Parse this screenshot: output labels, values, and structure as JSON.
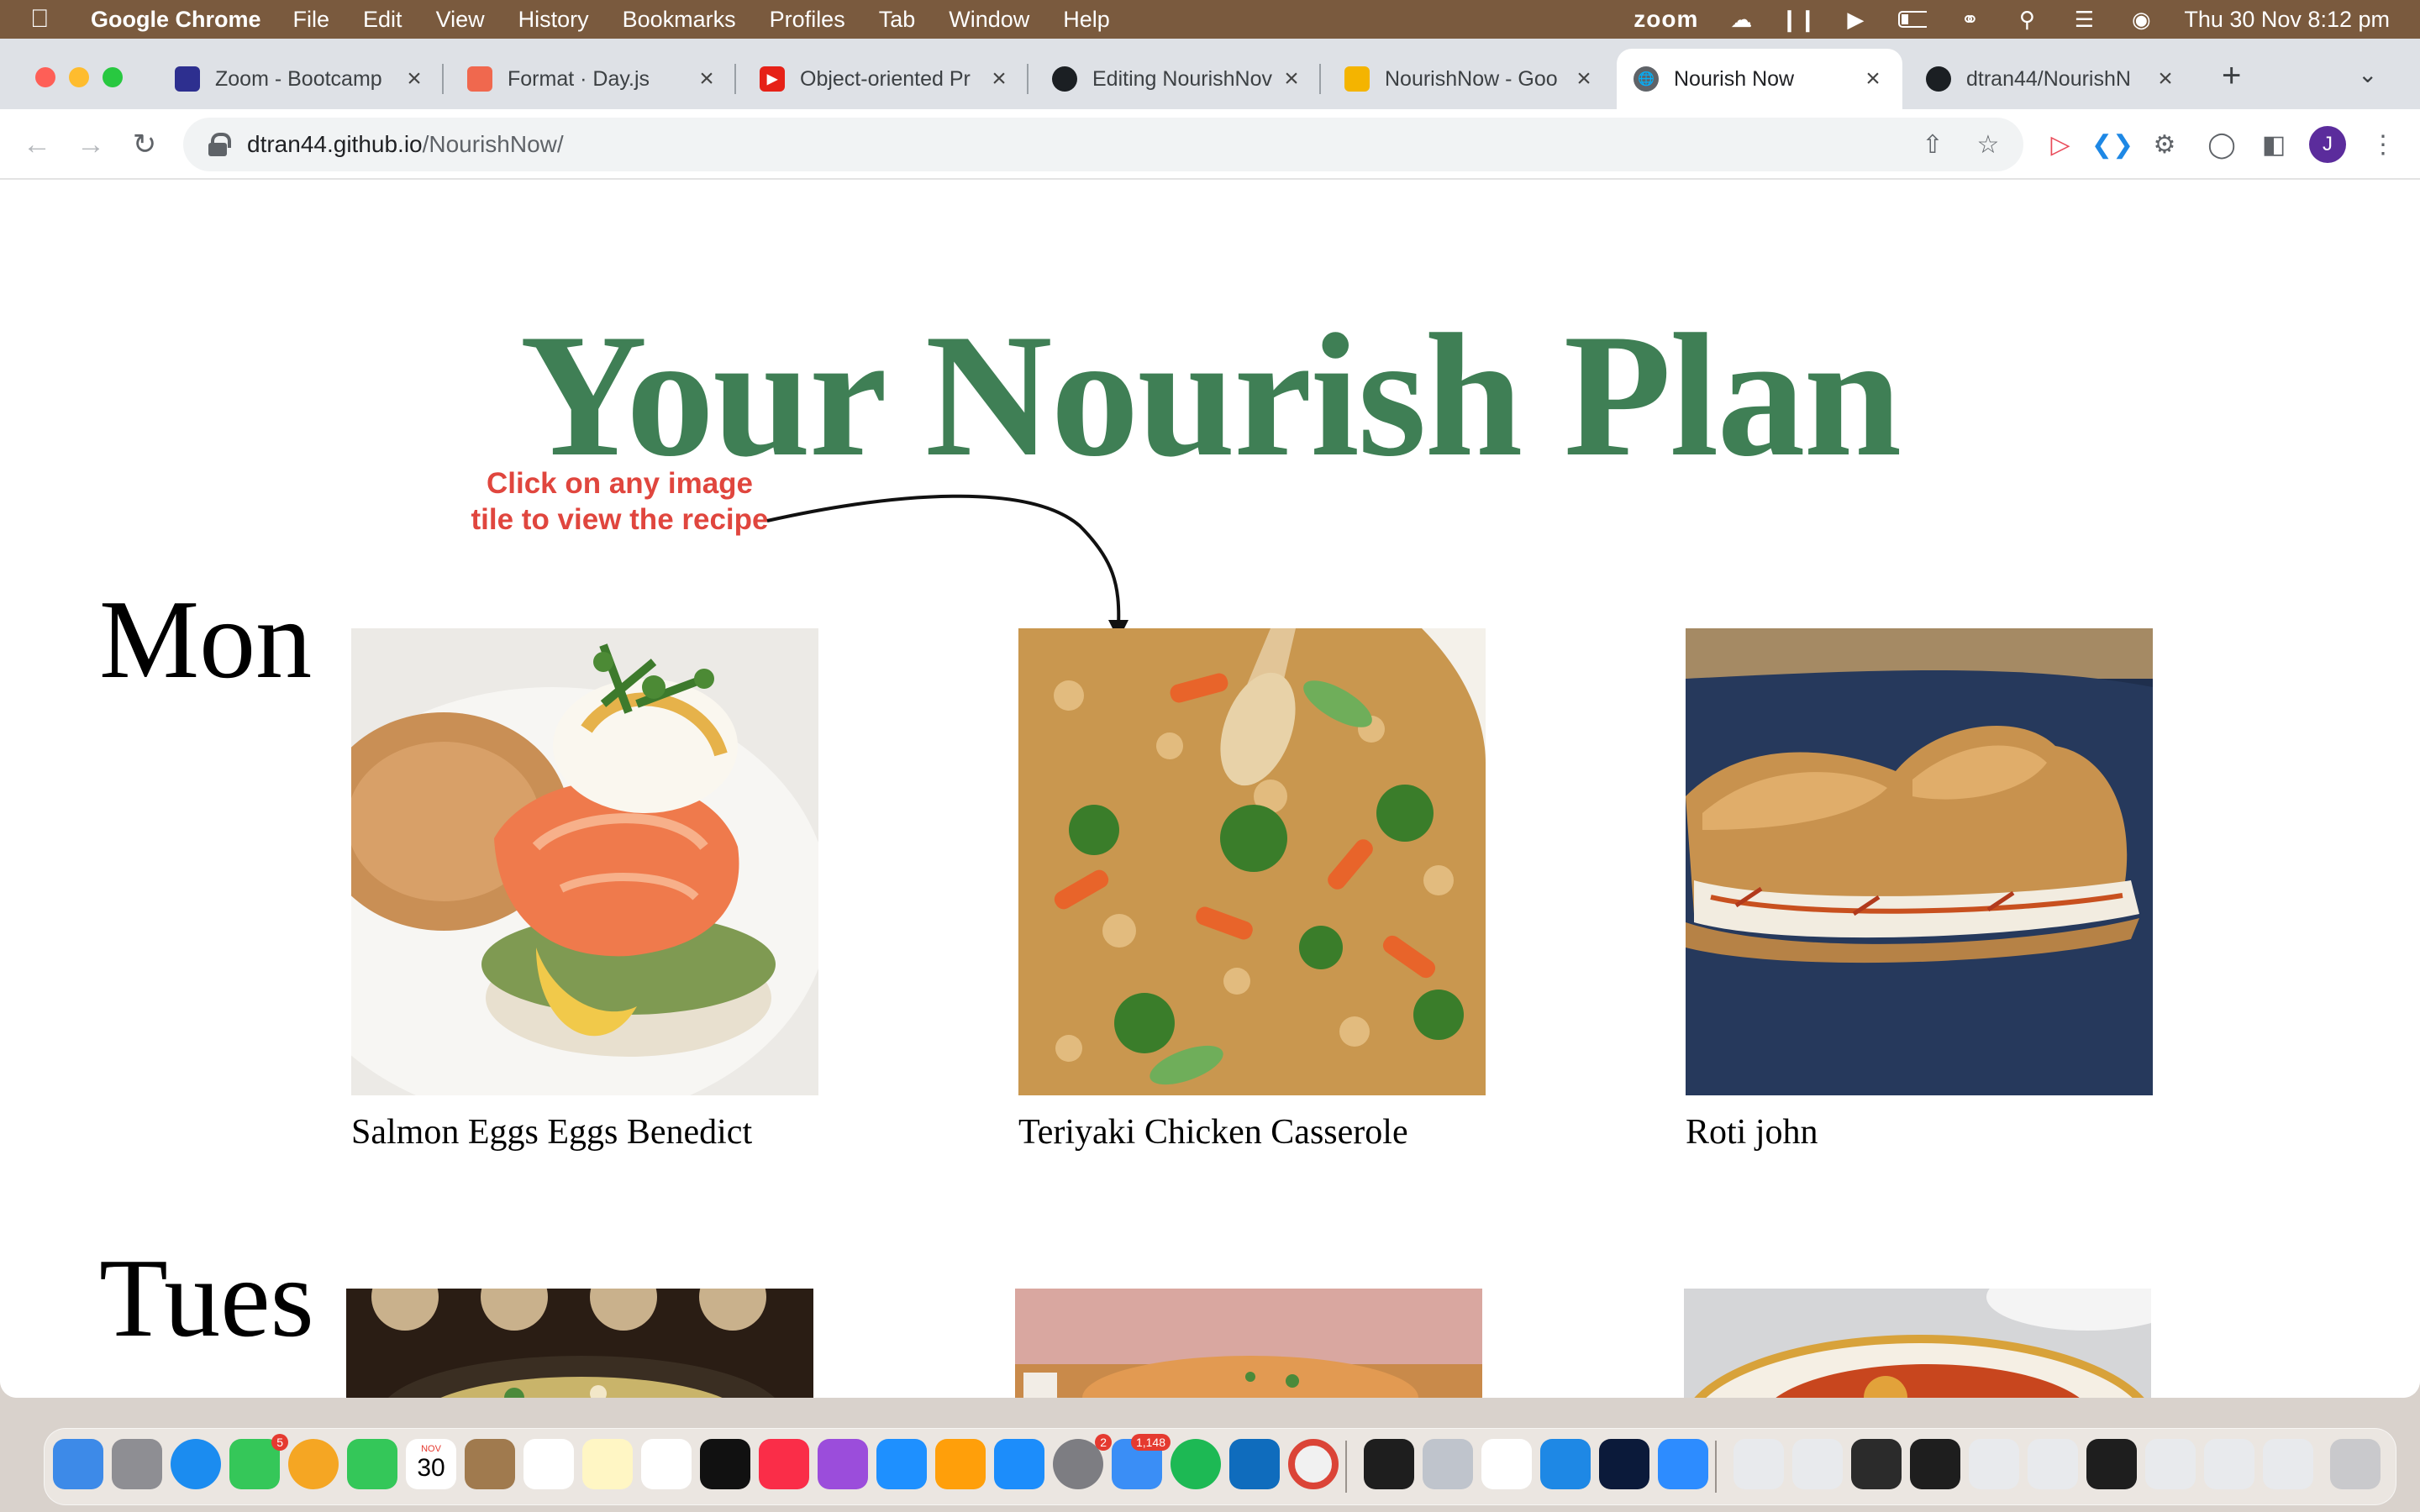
{
  "menubar": {
    "app_name": "Google Chrome",
    "menus": [
      "File",
      "Edit",
      "View",
      "History",
      "Bookmarks",
      "Profiles",
      "Tab",
      "Window",
      "Help"
    ],
    "zoom_label": "zoom",
    "clock": "Thu 30 Nov  8:12 pm"
  },
  "tabs": [
    {
      "title": "Zoom - Bootcamp",
      "favicon": "zoom-favicon",
      "color": "#2d2f8f"
    },
    {
      "title": "Format · Day.js",
      "favicon": "dayjs-favicon",
      "color": "#f0684e"
    },
    {
      "title": "Object-oriented Pr",
      "favicon": "youtube-favicon",
      "color": "#e62117"
    },
    {
      "title": "Editing NourishNov",
      "favicon": "github-favicon",
      "color": "#1b1f23"
    },
    {
      "title": "NourishNow - Goo",
      "favicon": "slides-favicon",
      "color": "#f4b400"
    },
    {
      "title": "Nourish Now",
      "favicon": "globe-favicon",
      "color": "#5f6368"
    },
    {
      "title": "dtran44/NourishN",
      "favicon": "github-favicon",
      "color": "#1b1f23"
    }
  ],
  "omnibox": {
    "host": "dtran44.github.io",
    "path": "/NourishNow/"
  },
  "profile_initial": "J",
  "page": {
    "title": "Your Nourish Plan",
    "hint": "Click on any image tile to view the recipe",
    "days": [
      {
        "label": "Mon",
        "meals": [
          {
            "name": "Salmon Eggs Eggs Benedict"
          },
          {
            "name": "Teriyaki Chicken Casserole"
          },
          {
            "name": "Roti john"
          }
        ]
      },
      {
        "label": "Tues",
        "meals": [
          {
            "name": ""
          },
          {
            "name": ""
          },
          {
            "name": ""
          }
        ]
      }
    ]
  },
  "dock": {
    "calendar_month": "NOV",
    "calendar_day": "30",
    "messages_badge": "5",
    "settings_badge": "2",
    "mail_badge": "1,148"
  }
}
